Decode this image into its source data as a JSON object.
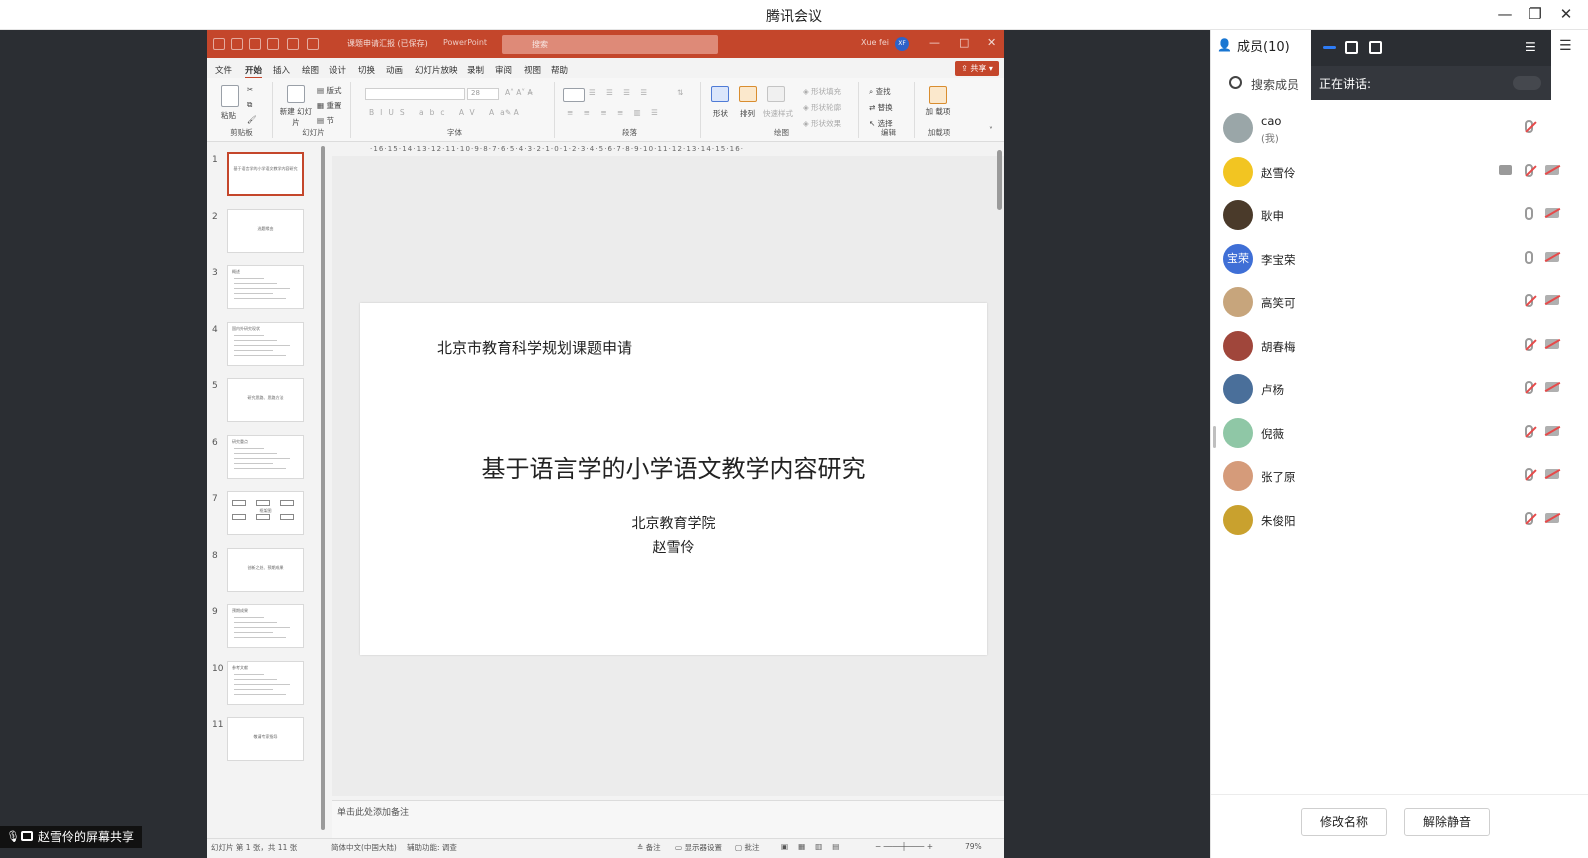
{
  "window": {
    "title": "腾讯会议"
  },
  "ppt": {
    "title_doc": "课题申请汇报 (已保存)",
    "app_name": "PowerPoint",
    "search_placeholder": "搜索",
    "user_name": "Xue fei",
    "user_initials": "XF",
    "share_label": "共享",
    "menu": [
      "文件",
      "开始",
      "插入",
      "绘图",
      "设计",
      "切换",
      "动画",
      "幻灯片放映",
      "录制",
      "审阅",
      "视图",
      "帮助"
    ],
    "active_menu": "开始",
    "ribbon_groups": {
      "clipboard": "剪贴板",
      "slides": "幻灯片",
      "font": "字体",
      "paragraph": "段落",
      "drawing": "绘图",
      "editing": "编辑",
      "addins": "加载项"
    },
    "ribbon_labels": {
      "paste": "粘贴",
      "new_slide": "新建\n幻灯片",
      "layout": "版式",
      "reset": "重置",
      "section": "节",
      "shapes": "形状",
      "arrange": "排列",
      "quick_styles": "快速样式",
      "shape_fill": "形状填充",
      "shape_outline": "形状轮廓",
      "shape_effects": "形状效果",
      "find": "查找",
      "replace": "替换",
      "select": "选择",
      "addins_btn": "加\n载项",
      "font_size": "28"
    },
    "ruler_text": "·16·15·14·13·12·11·10·9·8·7·6·5·4·3·2·1·0·1·2·3·4·5·6·7·8·9·10·11·12·13·14·15·16·",
    "thumbnails": [
      {
        "num": "1",
        "text": "基于语言学的小学语文教学内容研究"
      },
      {
        "num": "2",
        "text": "选题缘由"
      },
      {
        "num": "3",
        "text": "概述"
      },
      {
        "num": "4",
        "text": "国内外研究现状"
      },
      {
        "num": "5",
        "text": "研究思路、思路方法"
      },
      {
        "num": "6",
        "text": "研究重点"
      },
      {
        "num": "7",
        "text": "框架图"
      },
      {
        "num": "8",
        "text": "创新之处、预期成果"
      },
      {
        "num": "9",
        "text": "预期成果"
      },
      {
        "num": "10",
        "text": "参考文献"
      },
      {
        "num": "11",
        "text": "敬请专家指导"
      }
    ],
    "slide": {
      "header": "北京市教育科学规划课题申请",
      "title": "基于语言学的小学语文教学内容研究",
      "org": "北京教育学院",
      "author": "赵雪伶"
    },
    "notes_placeholder": "单击此处添加备注",
    "status": {
      "slide_pos": "幻灯片 第 1 张，共 11 张",
      "language": "简体中文(中国大陆)",
      "accessibility": "辅助功能: 调查",
      "notes": "备注",
      "display": "显示器设置",
      "comments": "批注",
      "zoom": "79%"
    }
  },
  "sharer": {
    "label": "赵雪伶的屏幕共享"
  },
  "panel": {
    "members_title": "成员(10)",
    "speaking_label": "正在讲话:",
    "search_label": "搜索成员",
    "members": [
      {
        "name": "cao",
        "sub": "(我)",
        "mic_muted": true,
        "cam": false,
        "sharing": false,
        "avatar_color": "#9aa6a8",
        "avatar_text": ""
      },
      {
        "name": "赵雪伶",
        "sub": "",
        "mic_muted": true,
        "cam": true,
        "sharing": true,
        "avatar_color": "#f2c522",
        "avatar_text": ""
      },
      {
        "name": "耿申",
        "sub": "",
        "mic_muted": false,
        "cam": true,
        "sharing": false,
        "avatar_color": "#4a3a2a",
        "avatar_text": ""
      },
      {
        "name": "李宝荣",
        "sub": "",
        "mic_muted": false,
        "cam": true,
        "sharing": false,
        "avatar_color": "#3f6fd6",
        "avatar_text": "宝荣"
      },
      {
        "name": "高笑可",
        "sub": "",
        "mic_muted": true,
        "cam": true,
        "sharing": false,
        "avatar_color": "#c7a57c",
        "avatar_text": ""
      },
      {
        "name": "胡春梅",
        "sub": "",
        "mic_muted": true,
        "cam": true,
        "sharing": false,
        "avatar_color": "#a0463b",
        "avatar_text": ""
      },
      {
        "name": "卢杨",
        "sub": "",
        "mic_muted": true,
        "cam": true,
        "sharing": false,
        "avatar_color": "#4a6f9a",
        "avatar_text": ""
      },
      {
        "name": "倪薇",
        "sub": "",
        "mic_muted": true,
        "cam": true,
        "sharing": false,
        "avatar_color": "#8fc7a6",
        "avatar_text": ""
      },
      {
        "name": "张了原",
        "sub": "",
        "mic_muted": true,
        "cam": true,
        "sharing": false,
        "avatar_color": "#d59b7a",
        "avatar_text": ""
      },
      {
        "name": "朱俊阳",
        "sub": "",
        "mic_muted": true,
        "cam": true,
        "sharing": false,
        "avatar_color": "#c9a12e",
        "avatar_text": ""
      }
    ],
    "buttons": {
      "rename": "修改名称",
      "unmute": "解除静音"
    }
  },
  "colors": {
    "ppt_accent": "#c4462b",
    "meeting_blue": "#2e7cf6",
    "dark_bg": "#2b2e33"
  }
}
